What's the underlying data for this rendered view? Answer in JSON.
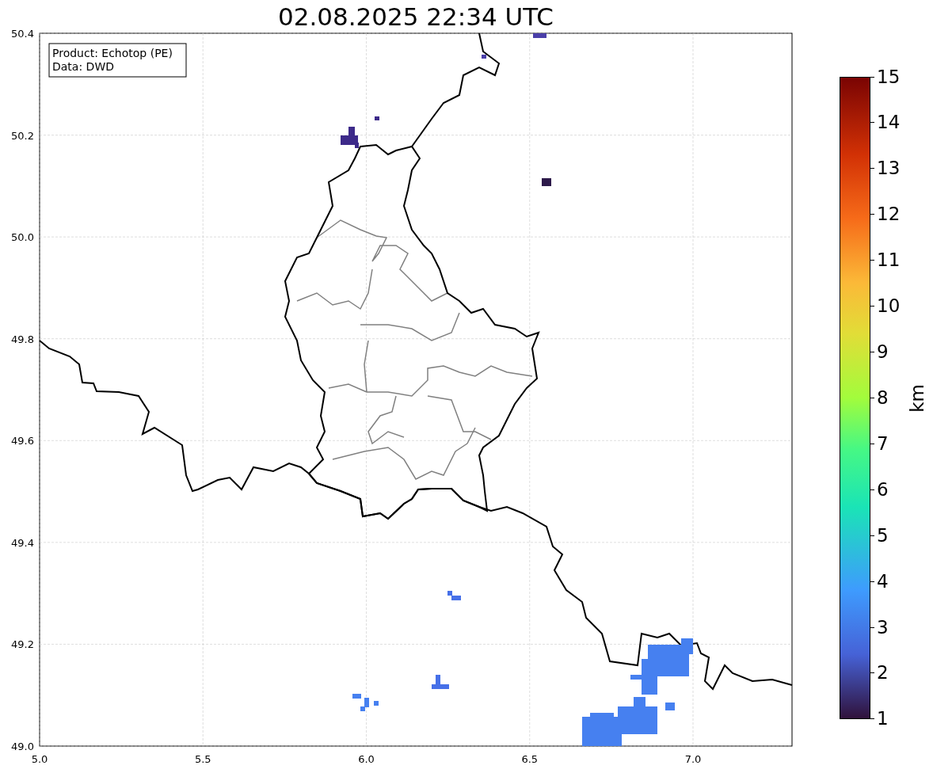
{
  "title": "02.08.2025 22:34 UTC",
  "info_box": {
    "lines": [
      "Product: Echotop (PE)",
      "Data: DWD"
    ]
  },
  "x_axis": {
    "ticks": [
      "5.0",
      "5.5",
      "6.0",
      "6.5",
      "7.0"
    ]
  },
  "y_axis": {
    "ticks": [
      "50.4",
      "50.2",
      "50.0",
      "49.8",
      "49.6",
      "49.4",
      "49.2",
      "49.0"
    ]
  },
  "colorbar": {
    "label": "km",
    "ticks": [
      "15",
      "14",
      "13",
      "12",
      "11",
      "10",
      "9",
      "8",
      "7",
      "6",
      "5",
      "4",
      "3",
      "2",
      "1"
    ]
  }
}
